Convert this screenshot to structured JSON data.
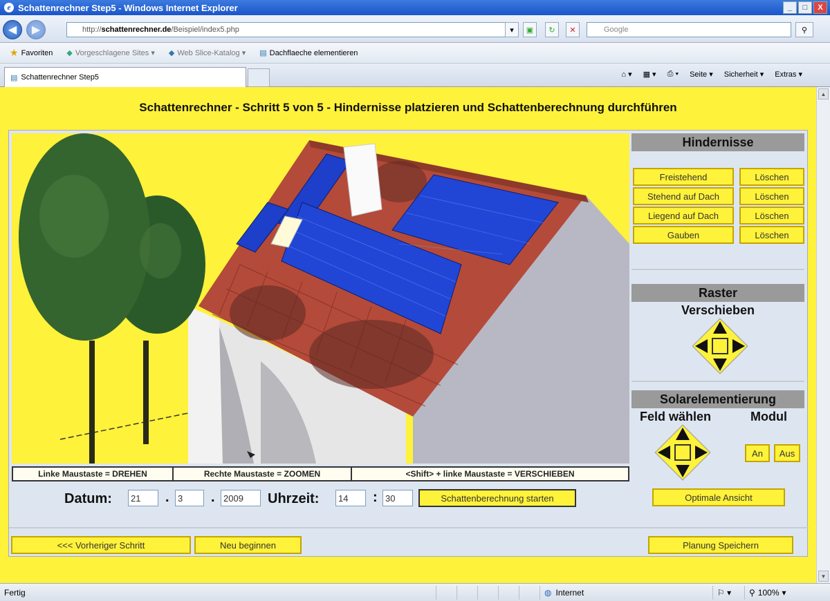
{
  "window": {
    "title": "Schattenrechner Step5 - Windows Internet Explorer",
    "buttons": [
      "_",
      "□",
      "X"
    ]
  },
  "address": {
    "prefix": "http://",
    "domain": "schattenrechner.de",
    "path": "/Beispiel/index5.php",
    "search_placeholder": "Google"
  },
  "favorites": {
    "label": "Favoriten",
    "items": [
      "Vorgeschlagene Sites ▾",
      "Web Slice-Katalog ▾",
      "Dachflaeche elementieren"
    ]
  },
  "tab": {
    "label": "Schattenrechner Step5",
    "commands": [
      "Seite ▾",
      "Sicherheit ▾",
      "Extras ▾"
    ]
  },
  "page": {
    "title": "Schattenrechner - Schritt 5 von 5 - Hindernisse platzieren und Schattenberechnung durchführen"
  },
  "viewport_help": [
    "Linke Maustaste = DREHEN",
    "Rechte Maustaste = ZOOMEN",
    "<Shift> + linke Maustaste = VERSCHIEBEN"
  ],
  "panel": {
    "hindernisse": {
      "title": "Hindernisse",
      "items": [
        {
          "label": "Freistehend",
          "delete": "Löschen"
        },
        {
          "label": "Stehend auf Dach",
          "delete": "Löschen"
        },
        {
          "label": "Liegend auf Dach",
          "delete": "Löschen"
        },
        {
          "label": "Gauben",
          "delete": "Löschen"
        }
      ]
    },
    "raster": {
      "title": "Raster",
      "subtitle": "Verschieben"
    },
    "solar": {
      "title": "Solarelementierung",
      "field_label": "Feld wählen",
      "module_label": "Modul",
      "on": "An",
      "off": "Aus"
    },
    "optimal_view": "Optimale Ansicht"
  },
  "datetime": {
    "date_label": "Datum:",
    "day": "21",
    "month": "3",
    "year": "2009",
    "time_label": "Uhrzeit:",
    "hour": "14",
    "minute": "30",
    "sep_dot": ".",
    "sep_colon": ":",
    "start_button": "Schattenberechnung starten"
  },
  "navigation": {
    "prev": "<<< Vorheriger Schritt",
    "restart": "Neu beginnen",
    "save": "Planung Speichern"
  },
  "statusbar": {
    "left": "Fertig",
    "zone": "Internet",
    "zoom": "100%"
  },
  "colors": {
    "page_bg": "#fff23a",
    "panel_bg": "#dde6f0",
    "solar_blue": "#1d3fc9",
    "roof_red": "#b44a3a"
  }
}
